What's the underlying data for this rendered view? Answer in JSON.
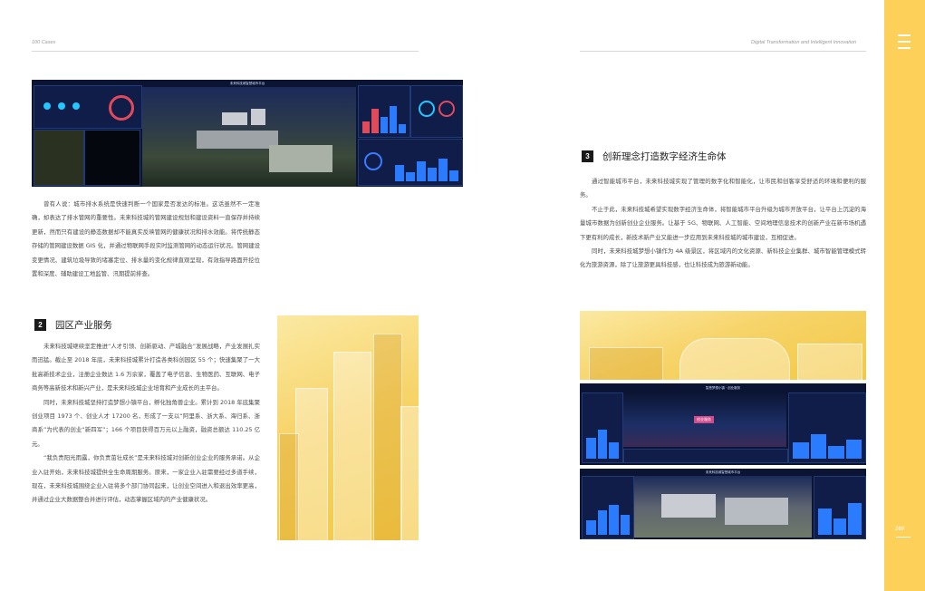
{
  "header": {
    "left_running_title": "100 Cases",
    "right_running_title": "Digital Transformation and Intelligent Innovation"
  },
  "sidebar": {
    "page_number": "269",
    "menu_icon": "hamburger-icon",
    "band_color": "#fdd05a"
  },
  "left_page": {
    "figure_top": {
      "dashboard_title": "未来科技城智慧城市平台"
    },
    "intro_paragraph": "曾有人说：城市排水系统是快速判断一个国家是否发达的标准。这话虽然不一定准确，却表达了排水管网的重要性。未来科技城的管网建设规划和建设资料一直保存并持续更新，然而只有建设的静态数据却不能真实反映管网的健康状况和排水效能。将传统静态存储的管网建设数据 GIS 化，并通过物联网手段实时监测管网的动态运行状况。管网建设变更情况、建筑垃圾导致的堵塞定位、排水量的变化规律直观呈现，有效指导路面开挖位置和深度、辅助建设工地监管、汛期提前排查。",
    "section2": {
      "number": "2",
      "title": "园区产业服务",
      "paragraphs": [
        "未来科技城继续坚定推进“人才引领、创新驱动、产城融合”发展战略，产业发展扎实而迅猛。截止至 2018 年底，未来科技城累计打造各类科创园区 55 个；快速集聚了一大批高新技术企业，注册企业数达 1.6 万余家，覆盖了电子信息、生物医药、互联网、电子商务等高新技术和新兴产业，是未来科技城企业培育和产业成长的主平台。",
        "同时，未来科技城坚持打造梦想小镇平台，孵化独角兽企业。累计到 2018 年底集聚创业项目 1973 个、创业人才 17200 名，形成了一支以“阿里系、浙大系、海归系、浙商系”为代表的创业“新四军”；166 个项目获得百万元以上融资，融资总额达 110.25 亿元。",
        "“我负责阳光雨露，你负责茁壮成长”是未来科技城对创新创业企业的服务承诺。从企业入驻开始，未来科技城提供全生命周期服务。原来，一家企业入驻需要经过多道手续，现在，未来科技城围绕企业入驻将多个部门协同起来，让创业空间进入和退出效率更高，并通过企业大数据整合并进行评估，动态掌握区域内的产业健康状况。"
      ]
    }
  },
  "right_page": {
    "section3": {
      "number": "3",
      "title": "创新理念打造数字经济生命体",
      "paragraphs": [
        "通过智能城市平台，未来科技城实现了管理的数字化和智能化，让市民和创客享受舒适的环境和便利的服务。",
        "不止于此，未来科技城希望实现数字经济生命体，将智能城市平台升级为城市开放平台，让平台上沉淀的海量城市数据为创新创业企业服务。让基于 5G、物联网、人工智能、空间地理信息技术的创新产业在新市场机遇下更有利的成长，新技术新产业又能进一步应用到未来科技城的城市建设，互相促进。",
        "同时，未来科技城梦想小镇作为 4A 级景区，将区域内的文化资源、新科技企业集群、城市智能管理模式转化为旅游资源，除了让旅游更具科技感，也让科技成为旅游新动能。"
      ]
    },
    "figure_middle": {
      "dashboard_title": "智慧梦想小镇 · 创业服务",
      "badge": "创业服务"
    },
    "figure_bottom": {
      "dashboard_title": "未来科技城智慧城市平台"
    }
  }
}
